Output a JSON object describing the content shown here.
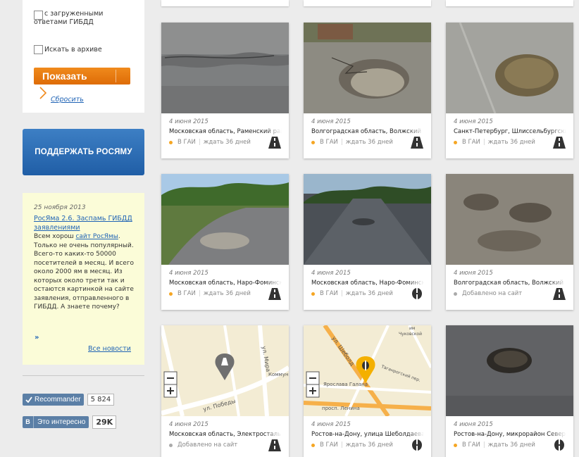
{
  "filter": {
    "checkbox_gibdd_label": "с загруженными ответами ГИБДД",
    "checkbox_archive_label": "Искать в архиве",
    "show_button": "Показать",
    "reset_link": "Сбросить"
  },
  "support_button": "ПОДДЕРЖАТЬ РОСЯМУ",
  "news": {
    "date": "25 ноября 2013",
    "title": "РосЯма 2.6. Заспамь ГИБДД заявлениями",
    "body_before": "Всем хорош ",
    "body_link": "сайт РосЯмы",
    "body_after": ". Только не очень популярный. Всего-то каких-то 50000 посетителей в месяц. И всего около 2000 ям в месяц. Из которых около трети так и остаются картинкой на сайте заявления, отправленного в ГИБДД. А знаете почему?",
    "more": "»",
    "all_news": "Все новости"
  },
  "social": {
    "recommend_label": "Recommander",
    "recommend_count": "5 824",
    "vk_letter": "В",
    "vk_label": "Это интересно",
    "vk_count": "29K"
  },
  "colors": {
    "status_gai": "#f5a623",
    "status_added": "#aaaaaa",
    "link": "#1f63b5",
    "orange_button": "#e8780f",
    "blue_button": "#2d6db5"
  },
  "cards": [
    {
      "date": "4 июня 2015",
      "address": "Московская область, Раменский район",
      "status": "В ГАИ",
      "wait": "ждать 36 дней",
      "status_type": "gai",
      "icon": "road-icon",
      "photo": "asphalt-crack"
    },
    {
      "date": "4 июня 2015",
      "address": "Волгоградская область, Волжский",
      "status": "В ГАИ",
      "wait": "ждать 36 дней",
      "status_type": "gai",
      "icon": "road-icon",
      "photo": "pothole-gravel"
    },
    {
      "date": "4 июня 2015",
      "address": "Санкт-Петербург, Шлиссельбургский",
      "status": "В ГАИ",
      "wait": "ждать 36 дней",
      "status_type": "gai",
      "icon": "road-icon",
      "photo": "pothole-patch"
    },
    {
      "date": "4 июня 2015",
      "address": "Московская область, Наро-Фоминск",
      "status": "В ГАИ",
      "wait": "ждать 36 дней",
      "status_type": "gai",
      "icon": "road-icon",
      "photo": "country-road"
    },
    {
      "date": "4 июня 2015",
      "address": "Московская область, Наро-Фоминск",
      "status": "В ГАИ",
      "wait": "ждать 36 дней",
      "status_type": "gai",
      "icon": "hatch-icon",
      "photo": "town-road"
    },
    {
      "date": "4 июня 2015",
      "address": "Волгоградская область, Волжский",
      "status": "Добавлено на сайт",
      "wait": "",
      "status_type": "added",
      "icon": "road-icon",
      "photo": "broken-asphalt"
    },
    {
      "date": "4 июня 2015",
      "address": "Московская область, Электросталь",
      "status": "Добавлено на сайт",
      "wait": "",
      "status_type": "added",
      "icon": "road-icon",
      "photo": "map-1",
      "map_streets": [
        "ул. Мира",
        "Коммун",
        "ул. Победы"
      ]
    },
    {
      "date": "4 июня 2015",
      "address": "Ростов-на-Дону, улица Шеболдаева",
      "status": "В ГАИ",
      "wait": "ждать 36 дней",
      "status_type": "gai",
      "icon": "hatch-icon",
      "photo": "map-2",
      "map_streets": [
        "ул. Шеболд",
        "Чуковской",
        "Таганрогский пер.",
        "Ярослава Галана",
        "просп. Ленина",
        "им"
      ]
    },
    {
      "date": "4 июня 2015",
      "address": "Ростов-на-Дону, микрорайон Северный",
      "status": "В ГАИ",
      "wait": "ждать 36 дней",
      "status_type": "gai",
      "icon": "hatch-icon",
      "photo": "dark-pothole"
    }
  ]
}
